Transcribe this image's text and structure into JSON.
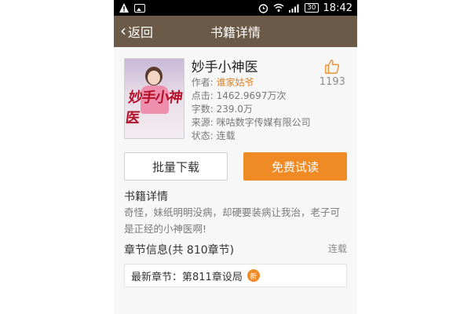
{
  "status_bar": {
    "time": "18:42",
    "battery": "30"
  },
  "app_bar": {
    "back_label": "返回",
    "title": "书籍详情"
  },
  "book": {
    "title": "妙手小神医",
    "author_label": "作者:",
    "author": "谁家姑爷",
    "clicks_label": "点击:",
    "clicks": "1462.9697万次",
    "words_label": "字数:",
    "words": "239.0万",
    "source_label": "来源:",
    "source": "咪咕数字传媒有限公司",
    "status_label": "状态:",
    "status": "连载",
    "likes": "1193",
    "cover_title": "妙手小神医"
  },
  "actions": {
    "download_label": "批量下载",
    "read_label": "免费试读"
  },
  "details": {
    "title": "书籍详情",
    "description": "奇怪，妹纸明明没病，却硬要装病让我治，老子可是正经的小神医啊!"
  },
  "chapters": {
    "title": "章节信息(共 810章节)",
    "status": "连载",
    "latest_label": "最新章节：第811章设局",
    "new_badge": "新"
  },
  "colors": {
    "app_bar": "#6c5a48",
    "accent_orange": "#f08a24",
    "author_link": "#d9822b"
  },
  "icons": [
    "warning-icon",
    "image-icon",
    "alarm-icon",
    "wifi-icon",
    "signal-icon",
    "battery-icon",
    "back-chevron-icon",
    "thumbs-up-icon",
    "new-badge-icon"
  ]
}
